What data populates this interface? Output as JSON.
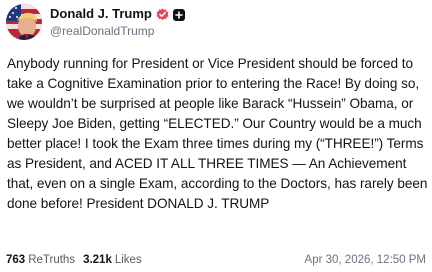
{
  "author": {
    "display_name": "Donald J. Trump",
    "handle": "@realDonaldTrump",
    "verified_icon": "verified-badge-icon",
    "extra_icon": "plus-box-icon",
    "avatar": "avatar"
  },
  "post": {
    "text": "Anybody running for President or Vice President should be forced to take a Cognitive Examination prior to entering the Race! By doing so, we wouldn’t be surprised at people like Barack “Hussein” Obama, or Sleepy Joe Biden, getting “ELECTED.” Our Country would be a much better place! I took the Exam three times during my (“THREE!”) Terms as President, and ACED IT ALL THREE TIMES — An Achievement that, even on a single Exam, according to the Doctors, has rarely been done before! President DONALD J. TRUMP"
  },
  "stats": {
    "retruths_count": "763",
    "retruths_label": "ReTruths",
    "likes_count": "3.21k",
    "likes_label": "Likes",
    "timestamp": "Apr 30, 2026, 12:50 PM"
  },
  "colors": {
    "verified_badge": "#e8455f",
    "plus_box": "#111111",
    "muted_text": "#6b7280"
  }
}
